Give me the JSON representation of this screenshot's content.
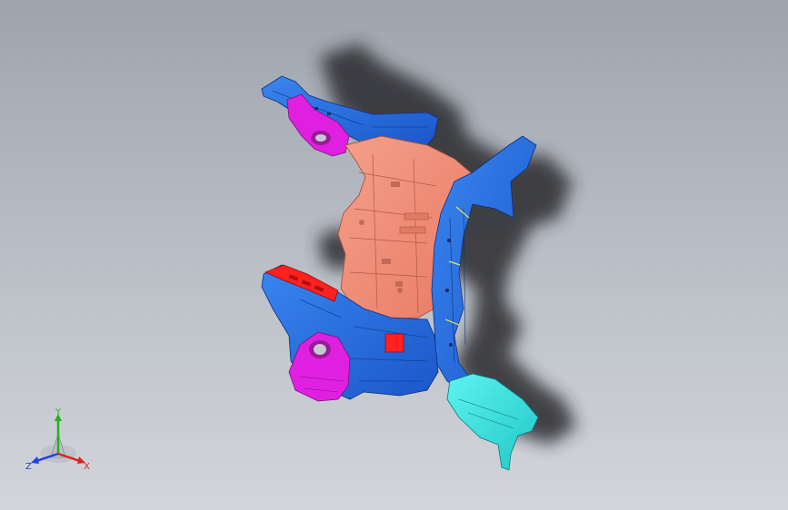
{
  "viewport": {
    "background_top": "#9ea4ad",
    "background_bottom": "#d2d5da"
  },
  "model": {
    "colors": {
      "blue": "#1f64d6",
      "blue_dark": "#133d9a",
      "salmon": "#f08a74",
      "salmon_dark": "#b75a47",
      "magenta": "#e020e0",
      "magenta_dark": "#8a148a",
      "red": "#ff2020",
      "cyan": "#2fe0e0",
      "cyan_dark": "#129090",
      "shadow": "#2a2a2e"
    }
  },
  "triad": {
    "x_label": "X",
    "y_label": "Y",
    "z_label": "Z",
    "x_color": "#e02020",
    "y_color": "#20b020",
    "z_color": "#2040e0"
  }
}
